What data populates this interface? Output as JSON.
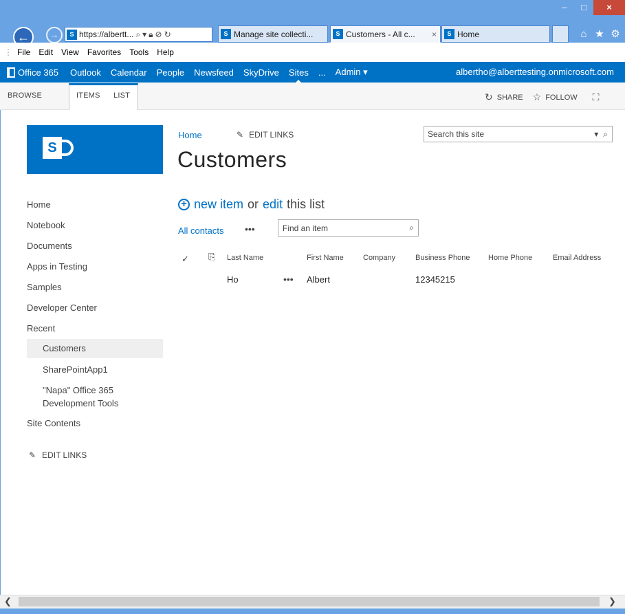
{
  "browser": {
    "address_url": "https://albertt...",
    "tabs": [
      {
        "label": "Manage site collecti..."
      },
      {
        "label": "Customers - All c...",
        "close": "×"
      },
      {
        "label": "Home"
      }
    ],
    "favicon_text": "S",
    "menu": [
      "File",
      "Edit",
      "View",
      "Favorites",
      "Tools",
      "Help"
    ],
    "window_controls": {
      "minimize": "–",
      "maximize": "□",
      "close": "×"
    }
  },
  "suitebar": {
    "brand": "Office 365",
    "links": [
      "Outlook",
      "Calendar",
      "People",
      "Newsfeed",
      "SkyDrive",
      "Sites",
      "...",
      "Admin ▾"
    ],
    "user": "albertho@alberttesting.onmicrosoft.com"
  },
  "ribbon": {
    "tabs": [
      "BROWSE",
      "ITEMS",
      "LIST"
    ],
    "share": "SHARE",
    "follow": "FOLLOW"
  },
  "site": {
    "logo_letter": "S",
    "breadcrumb_home": "Home",
    "edit_links": "EDIT LINKS",
    "title": "Customers",
    "search_placeholder": "Search this site"
  },
  "leftnav": {
    "items": [
      "Home",
      "Notebook",
      "Documents",
      "Apps in Testing",
      "Samples",
      "Developer Center",
      "Recent"
    ],
    "recent": [
      "Customers",
      "SharePointApp1",
      "\"Napa\" Office 365",
      "Development Tools"
    ],
    "site_contents": "Site Contents",
    "edit_links": "EDIT LINKS"
  },
  "list": {
    "new_item": "new item",
    "or": "or",
    "edit": "edit",
    "this_list": "this list",
    "view_name": "All contacts",
    "view_ellipsis": "•••",
    "find_placeholder": "Find an item",
    "columns": [
      "Last Name",
      "First Name",
      "Company",
      "Business Phone",
      "Home Phone",
      "Email Address"
    ],
    "rows": [
      {
        "last_name": "Ho",
        "ellipsis": "•••",
        "first_name": "Albert",
        "company": "",
        "business_phone": "12345215",
        "home_phone": "",
        "email": ""
      }
    ]
  },
  "colors": {
    "accent": "#0072c6",
    "window_frame": "#6aa3e3",
    "close_button": "#c7493a"
  }
}
